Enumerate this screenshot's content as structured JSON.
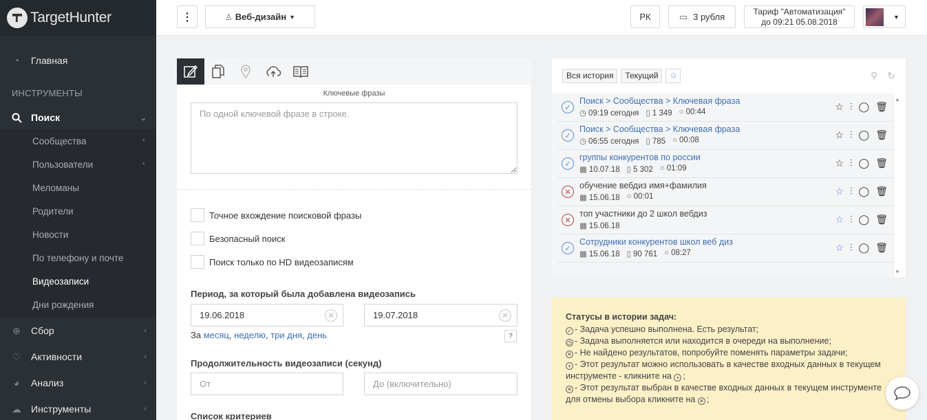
{
  "app": {
    "logo_text": "TargetHunter"
  },
  "sidebar": {
    "main_label": "Главная",
    "section_title": "ИНСТРУМЕНТЫ",
    "search_label": "Поиск",
    "sub_items": [
      "Сообщества",
      "Пользователи",
      "Меломаны",
      "Родители",
      "Новости",
      "По телефону и почте",
      "Видеозаписи",
      "Дни рождения"
    ],
    "active_sub": "Видеозаписи",
    "collect_label": "Сбор",
    "activity_label": "Активности",
    "analysis_label": "Анализ",
    "tools_label": "Инструменты"
  },
  "topbar": {
    "menu_icon": "vertical-dots-icon",
    "project_label": "Веб-дизайн",
    "rk_label": "РК",
    "balance_label": "3 рубля",
    "tariff_line1": "Тариф \"Автоматизация\"",
    "tariff_line2": "до 09:21 05.08.2018"
  },
  "form": {
    "keywords_label": "Ключевые фразы",
    "keywords_placeholder": "По одной ключевой фразе в строке.",
    "chk_exact": "Точное вхождение поисковой фразы",
    "chk_safe": "Безопасный поиск",
    "chk_hd": "Поиск только по HD видеозаписям",
    "period_label": "Период, за который была добавлена видеозапись",
    "date_from": "19.06.2018",
    "date_to": "19.07.2018",
    "period_prefix": "За",
    "period_month": "месяц",
    "period_week": "неделю",
    "period_3days": "три дня",
    "period_day": "день",
    "help_label": "?",
    "duration_label": "Продолжительность видеозаписи (секунд)",
    "duration_from_placeholder": "От",
    "duration_to_placeholder": "До (включительно)",
    "criteria_label": "Список критериев"
  },
  "history": {
    "tab_all": "Вся история",
    "tab_current": "Текущий",
    "rows": [
      {
        "title": "Поиск > Сообщества > Ключевая фраза",
        "link": true,
        "status": "ok",
        "time": "09:19 сегодня",
        "count": "1 349",
        "duration": "00:44",
        "star_blue": false
      },
      {
        "title": "Поиск > Сообщества > Ключевая фраза",
        "link": true,
        "status": "ok",
        "time": "06:55 сегодня",
        "count": "785",
        "duration": "00:08",
        "star_blue": false
      },
      {
        "title": "группы конкурентов по россии",
        "link": true,
        "status": "ok",
        "time": "10.07.18",
        "count": "5 302",
        "duration": "01:09",
        "star_blue": false
      },
      {
        "title": "обучение вебдиз имя+фамилия",
        "link": false,
        "status": "err",
        "time": "15.06.18",
        "count": "",
        "duration": "00:01",
        "star_blue": true
      },
      {
        "title": "топ участники до 2 школ вебдиз",
        "link": false,
        "status": "err",
        "time": "15.06.18",
        "count": "",
        "duration": "",
        "star_blue": true
      },
      {
        "title": "Сотрудники конкурентов школ веб диз",
        "link": true,
        "status": "ok",
        "time": "15.06.18",
        "count": "90 761",
        "duration": "08:27",
        "star_blue": true
      }
    ]
  },
  "statuses": {
    "title": "Статусы в истории задач:",
    "line1": "- Задача успешно выполнена. Есть результат;",
    "line2": "- Задача выполняется или находится в очереди на выполнение;",
    "line3": "- Не найдено результатов, попробуйте поменять параметры задачи;",
    "line4a": "- Этот результат можно использовать в качестве входных данных в текущем",
    "line4b": "инструменте - кликните на",
    "line5a": "- Этот результат выбран в качестве входных данных в текущем инструменте",
    "line5b": "для отмены выбора кликните на"
  }
}
